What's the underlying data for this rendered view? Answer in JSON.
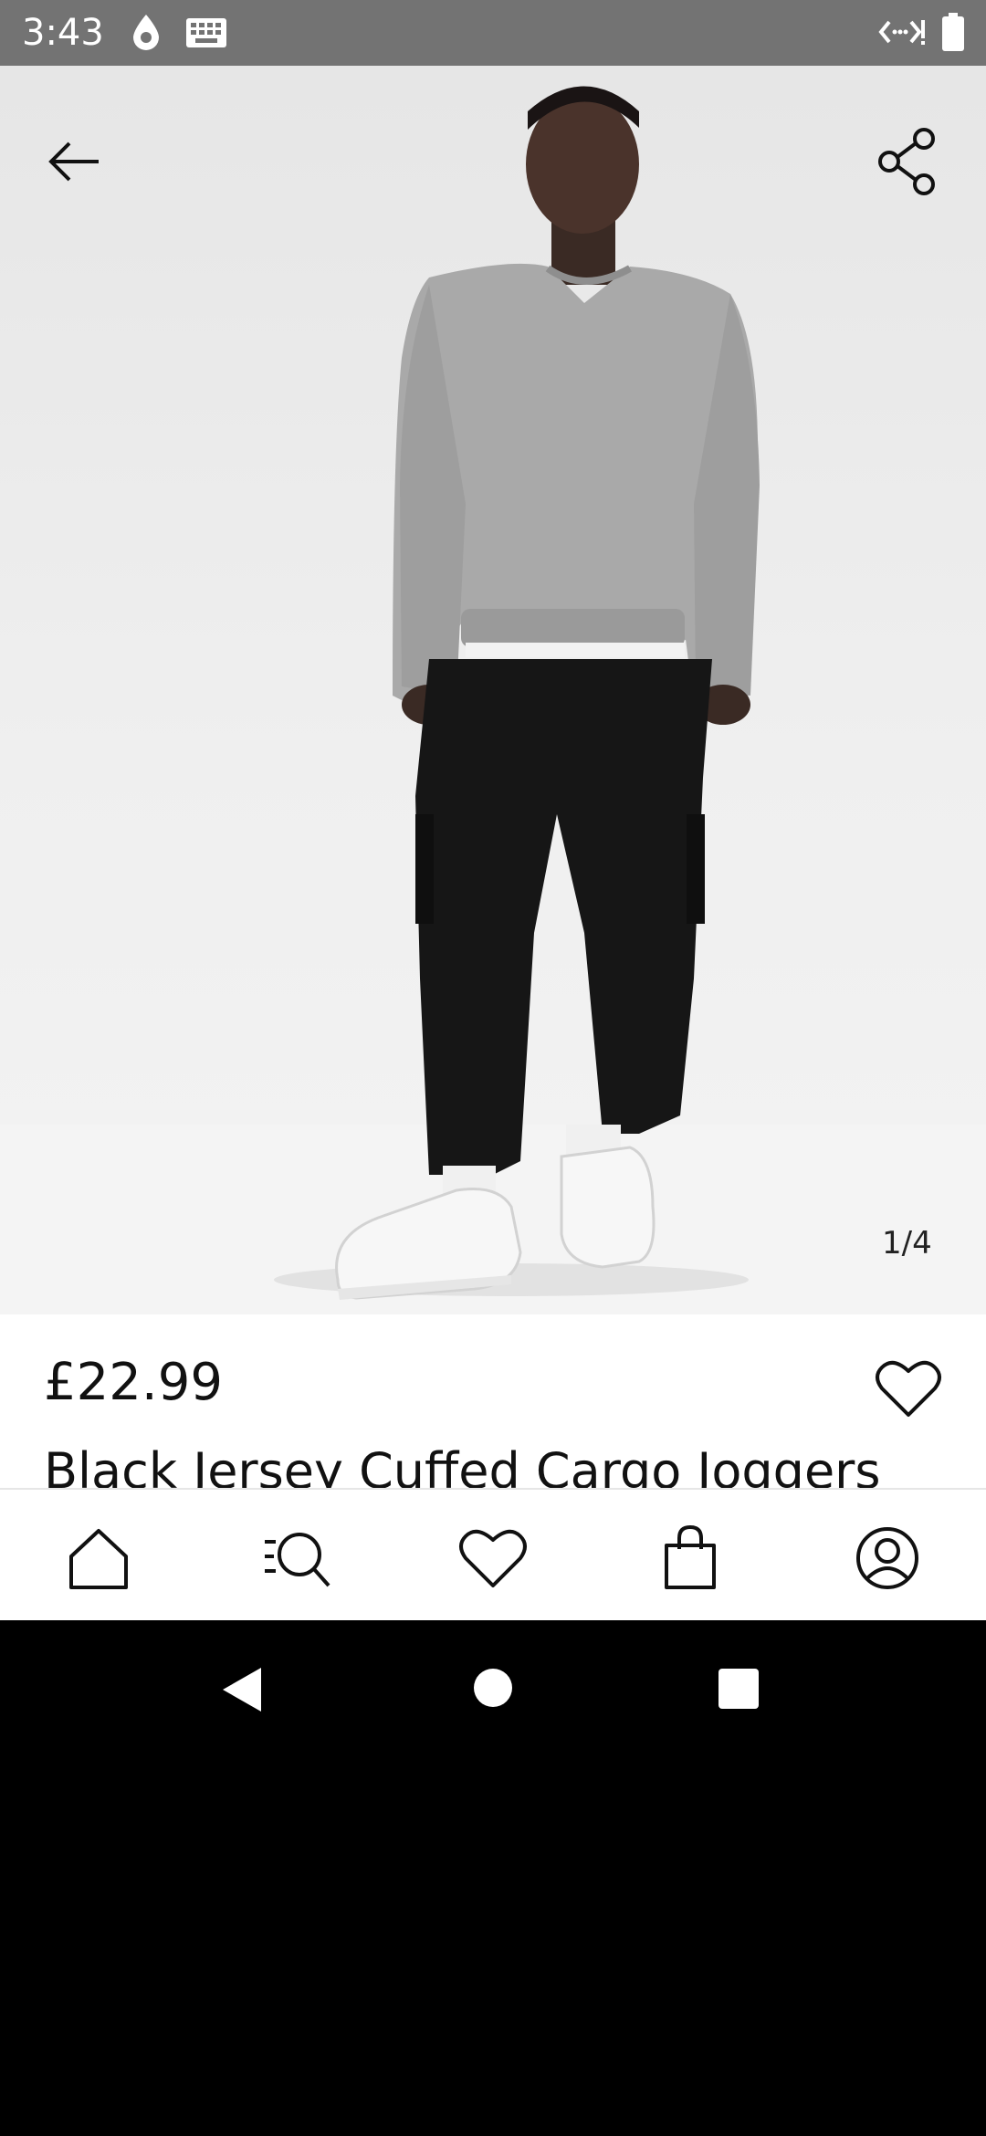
{
  "status_bar": {
    "time": "3:43",
    "icons": [
      "drop-icon",
      "keyboard-icon",
      "code-icon",
      "battery-icon"
    ]
  },
  "gallery": {
    "counter": "1/4",
    "current_image": 1,
    "total_images": 4,
    "progress_fraction": 0.25
  },
  "product": {
    "price": "£22.99",
    "title": "Black Jersey Cuffed Cargo Joggers"
  },
  "bottom_nav": {
    "items": [
      "home-icon",
      "search-icon",
      "heart-icon",
      "bag-icon",
      "account-icon"
    ]
  },
  "system_nav": [
    "back",
    "home",
    "recents"
  ]
}
